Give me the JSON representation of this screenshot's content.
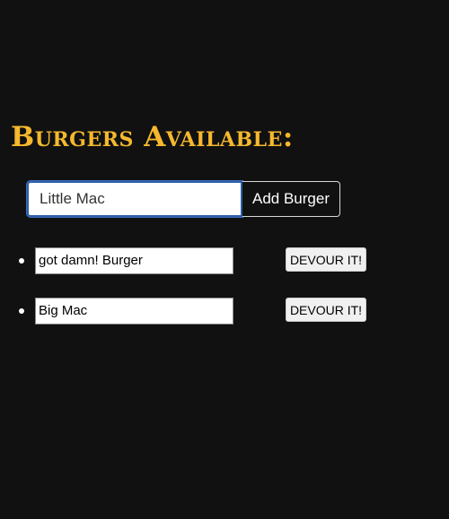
{
  "page": {
    "heading": "Burgers Available:"
  },
  "add_form": {
    "input_value": "Little Mac",
    "add_button_label": "Add Burger"
  },
  "burgers": [
    {
      "name": "got damn! Burger",
      "devour_label": "DEVOUR IT!"
    },
    {
      "name": "Big Mac",
      "devour_label": "DEVOUR IT!"
    }
  ],
  "colors": {
    "background": "#111111",
    "heading": "#f5b82e",
    "input_focus_border": "#2d5da8"
  }
}
